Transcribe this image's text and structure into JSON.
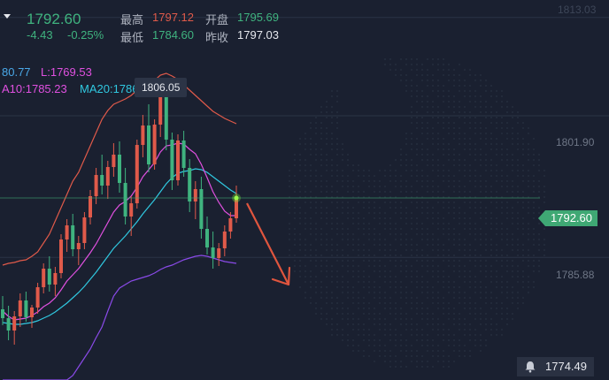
{
  "quote": {
    "price": "1792.60",
    "change": "-4.43",
    "change_pct": "-0.25%",
    "high_label": "最高",
    "high": "1797.12",
    "open_label": "开盘",
    "open": "1795.69",
    "low_label": "最低",
    "low": "1784.60",
    "prev_close_label": "昨收",
    "prev_close": "1797.03"
  },
  "indicators": {
    "upper": "80.77",
    "lower": "L:1769.53",
    "ma10": "A10:1785.23",
    "ma20": "MA20:1786.0"
  },
  "tooltip": "1806.05",
  "current_price_tag": "1792.60",
  "bottom_price": "1774.49",
  "y_axis": {
    "top_label": "1813.03",
    "labels": [
      "1801.90",
      "1785.88"
    ]
  },
  "colors": {
    "up": "#e05a4a",
    "down": "#3fb37f",
    "ma10": "#e050e0",
    "ma20": "#30c8e0",
    "boll_upper": "#e05a4a",
    "boll_lower": "#8a4ae8",
    "arrow": "#e0553e"
  },
  "chart_data": {
    "type": "candlestick",
    "ylim": [
      1772,
      1815
    ],
    "candles": [
      [
        1780.0,
        1781.5,
        1778.2,
        1779.0
      ],
      [
        1779.0,
        1780.4,
        1776.5,
        1777.6
      ],
      [
        1777.6,
        1779.8,
        1776.0,
        1779.2
      ],
      [
        1779.2,
        1781.8,
        1778.0,
        1781.0
      ],
      [
        1781.0,
        1782.0,
        1778.6,
        1779.1
      ],
      [
        1779.1,
        1780.5,
        1777.9,
        1780.2
      ],
      [
        1780.2,
        1783.0,
        1779.5,
        1782.5
      ],
      [
        1782.5,
        1785.2,
        1781.8,
        1784.6
      ],
      [
        1784.6,
        1786.0,
        1782.0,
        1782.8
      ],
      [
        1782.8,
        1784.8,
        1781.5,
        1784.1
      ],
      [
        1784.1,
        1788.5,
        1783.5,
        1787.9
      ],
      [
        1787.9,
        1790.2,
        1786.5,
        1789.5
      ],
      [
        1789.5,
        1790.8,
        1786.0,
        1786.8
      ],
      [
        1786.8,
        1788.3,
        1785.0,
        1787.5
      ],
      [
        1787.5,
        1791.0,
        1786.8,
        1790.4
      ],
      [
        1790.4,
        1793.5,
        1789.6,
        1792.8
      ],
      [
        1792.8,
        1796.0,
        1791.9,
        1795.2
      ],
      [
        1795.2,
        1797.5,
        1793.0,
        1794.0
      ],
      [
        1794.0,
        1796.8,
        1792.5,
        1796.1
      ],
      [
        1796.1,
        1798.8,
        1795.0,
        1797.5
      ],
      [
        1797.5,
        1799.0,
        1793.2,
        1794.3
      ],
      [
        1794.3,
        1796.0,
        1789.6,
        1790.5
      ],
      [
        1790.5,
        1792.8,
        1788.3,
        1792.0
      ],
      [
        1792.0,
        1799.2,
        1791.4,
        1798.6
      ],
      [
        1798.6,
        1802.0,
        1797.2,
        1800.8
      ],
      [
        1800.8,
        1803.2,
        1795.5,
        1796.4
      ],
      [
        1796.4,
        1801.5,
        1795.8,
        1800.9
      ],
      [
        1800.9,
        1806.05,
        1799.5,
        1805.0
      ],
      [
        1805.0,
        1805.6,
        1798.0,
        1799.2
      ],
      [
        1799.2,
        1800.0,
        1793.5,
        1794.6
      ],
      [
        1794.6,
        1799.8,
        1794.0,
        1799.1
      ],
      [
        1799.1,
        1800.2,
        1795.0,
        1796.0
      ],
      [
        1796.0,
        1797.0,
        1791.0,
        1792.2
      ],
      [
        1792.2,
        1794.5,
        1790.2,
        1793.6
      ],
      [
        1793.6,
        1795.0,
        1788.0,
        1789.1
      ],
      [
        1789.1,
        1790.5,
        1786.2,
        1787.0
      ],
      [
        1787.0,
        1788.8,
        1784.6,
        1785.8
      ],
      [
        1785.8,
        1787.5,
        1784.9,
        1786.9
      ],
      [
        1786.9,
        1789.5,
        1786.0,
        1788.8
      ],
      [
        1788.8,
        1791.0,
        1788.0,
        1790.3
      ],
      [
        1790.3,
        1794.0,
        1789.8,
        1792.6
      ]
    ],
    "ma10": [
      1779.8,
      1779.2,
      1778.8,
      1778.9,
      1779.0,
      1779.3,
      1779.7,
      1780.3,
      1780.7,
      1781.3,
      1782.2,
      1783.2,
      1783.9,
      1784.6,
      1785.5,
      1786.4,
      1787.4,
      1788.6,
      1789.8,
      1791.0,
      1791.8,
      1792.2,
      1792.8,
      1793.8,
      1795.0,
      1795.8,
      1796.6,
      1797.8,
      1798.5,
      1798.6,
      1798.8,
      1798.7,
      1798.1,
      1797.6,
      1796.4,
      1794.9,
      1793.3,
      1792.1,
      1791.1,
      1790.6,
      1790.6
    ],
    "ma20": [
      1778.5,
      1778.4,
      1778.3,
      1778.3,
      1778.4,
      1778.5,
      1778.7,
      1779.0,
      1779.3,
      1779.7,
      1780.2,
      1780.7,
      1781.3,
      1781.9,
      1782.6,
      1783.4,
      1784.2,
      1785.1,
      1786.0,
      1786.9,
      1787.6,
      1788.3,
      1789.1,
      1789.9,
      1790.8,
      1791.6,
      1792.4,
      1793.3,
      1794.2,
      1794.9,
      1795.4,
      1795.6,
      1795.7,
      1795.9,
      1795.8,
      1795.5,
      1795.0,
      1794.5,
      1794.0,
      1793.5,
      1793.1
    ],
    "boll_upper": [
      1785.0,
      1785.2,
      1785.3,
      1785.5,
      1785.6,
      1786.0,
      1786.5,
      1787.5,
      1788.5,
      1790.0,
      1791.5,
      1793.0,
      1794.5,
      1795.5,
      1797.0,
      1798.5,
      1800.0,
      1801.5,
      1802.5,
      1803.2,
      1803.5,
      1803.8,
      1804.2,
      1804.8,
      1805.3,
      1805.6,
      1805.9,
      1806.5,
      1806.7,
      1806.4,
      1806.0,
      1805.4,
      1804.8,
      1804.2,
      1803.6,
      1803.0,
      1802.4,
      1802.0,
      1801.6,
      1801.3,
      1801.0
    ],
    "boll_lower": [
      1772.0,
      1772.0,
      1772.0,
      1772.0,
      1772.0,
      1772.0,
      1772.0,
      1772.0,
      1772.0,
      1772.0,
      1772.0,
      1772.0,
      1772.5,
      1773.5,
      1774.5,
      1775.5,
      1776.8,
      1778.0,
      1779.8,
      1781.5,
      1782.4,
      1782.8,
      1783.2,
      1783.4,
      1783.6,
      1783.8,
      1784.1,
      1784.5,
      1784.8,
      1785.0,
      1785.3,
      1785.6,
      1785.8,
      1786.0,
      1786.1,
      1786.0,
      1785.8,
      1785.6,
      1785.4,
      1785.3,
      1785.2
    ]
  }
}
